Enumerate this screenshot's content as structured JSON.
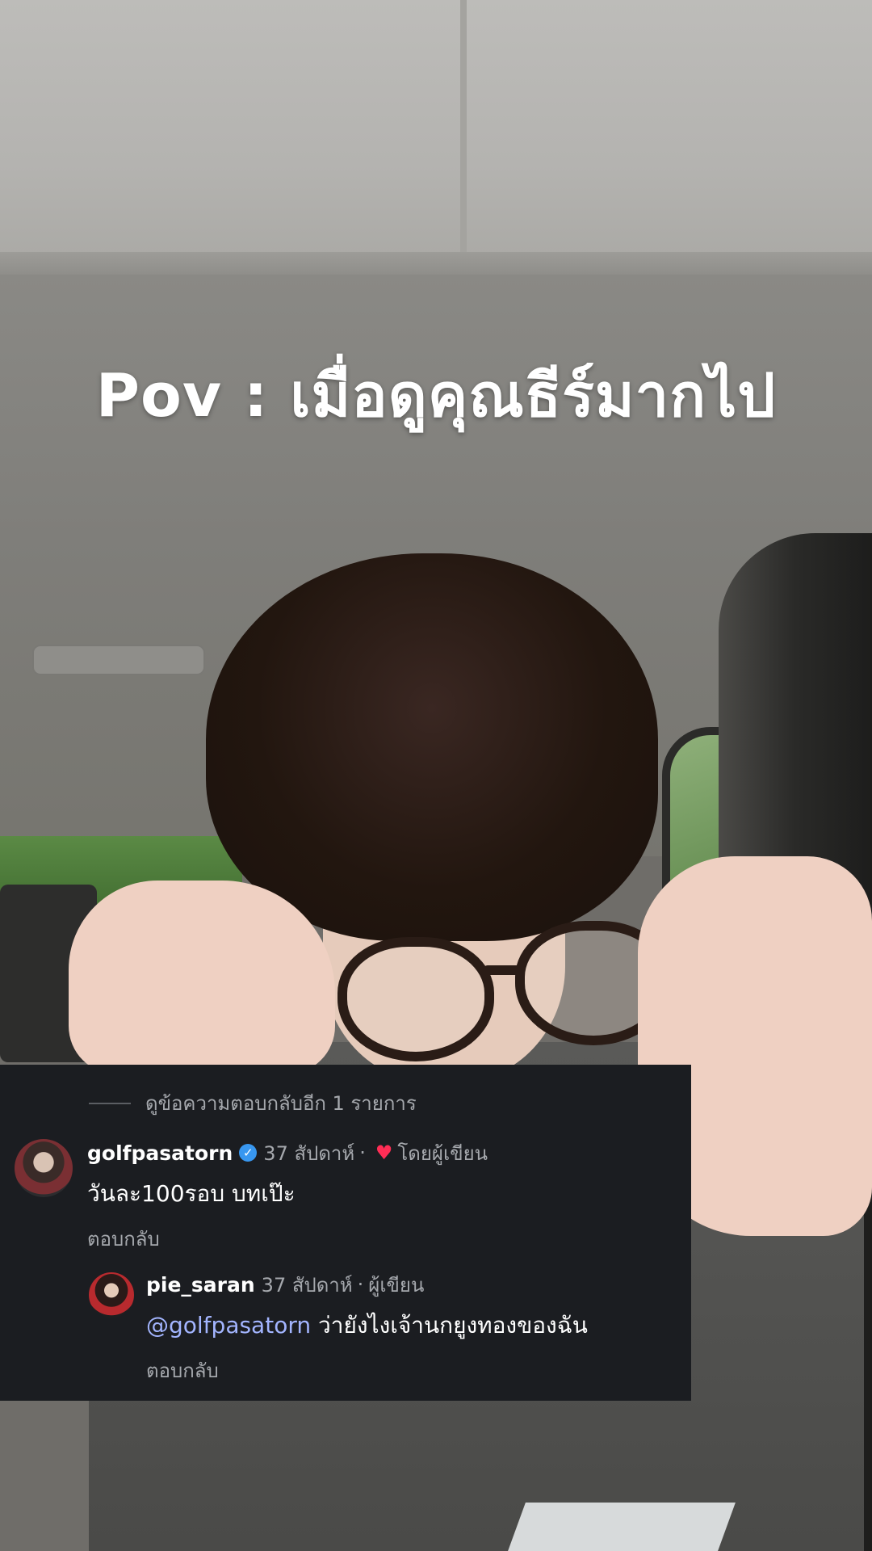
{
  "video": {
    "caption": "Pov : เมื่อดูคุณธีร์มากไป"
  },
  "comments": {
    "view_more": "ดูข้อความตอบกลับอีก 1 รายการ",
    "items": [
      {
        "username": "golfpasatorn",
        "verified": true,
        "time": "37 สัปดาห์",
        "liked_by_author_label": "โดยผู้เขียน",
        "text": "วันละ100รอบ บทเป๊ะ",
        "reply_label": "ตอบกลับ"
      },
      {
        "username": "pie_saran",
        "time": "37 สัปดาห์",
        "author_label": "ผู้เขียน",
        "mention": "@golfpasatorn",
        "text": " ว่ายังไงเจ้านกยูงทองของฉัน",
        "reply_label": "ตอบกลับ"
      }
    ]
  },
  "icons": {
    "verified": "verified-badge-icon",
    "heart": "heart-icon"
  },
  "colors": {
    "panel_bg": "#1b1d21",
    "mention": "#a3b5ff",
    "heart": "#ff2d55",
    "verified": "#3897f0"
  }
}
